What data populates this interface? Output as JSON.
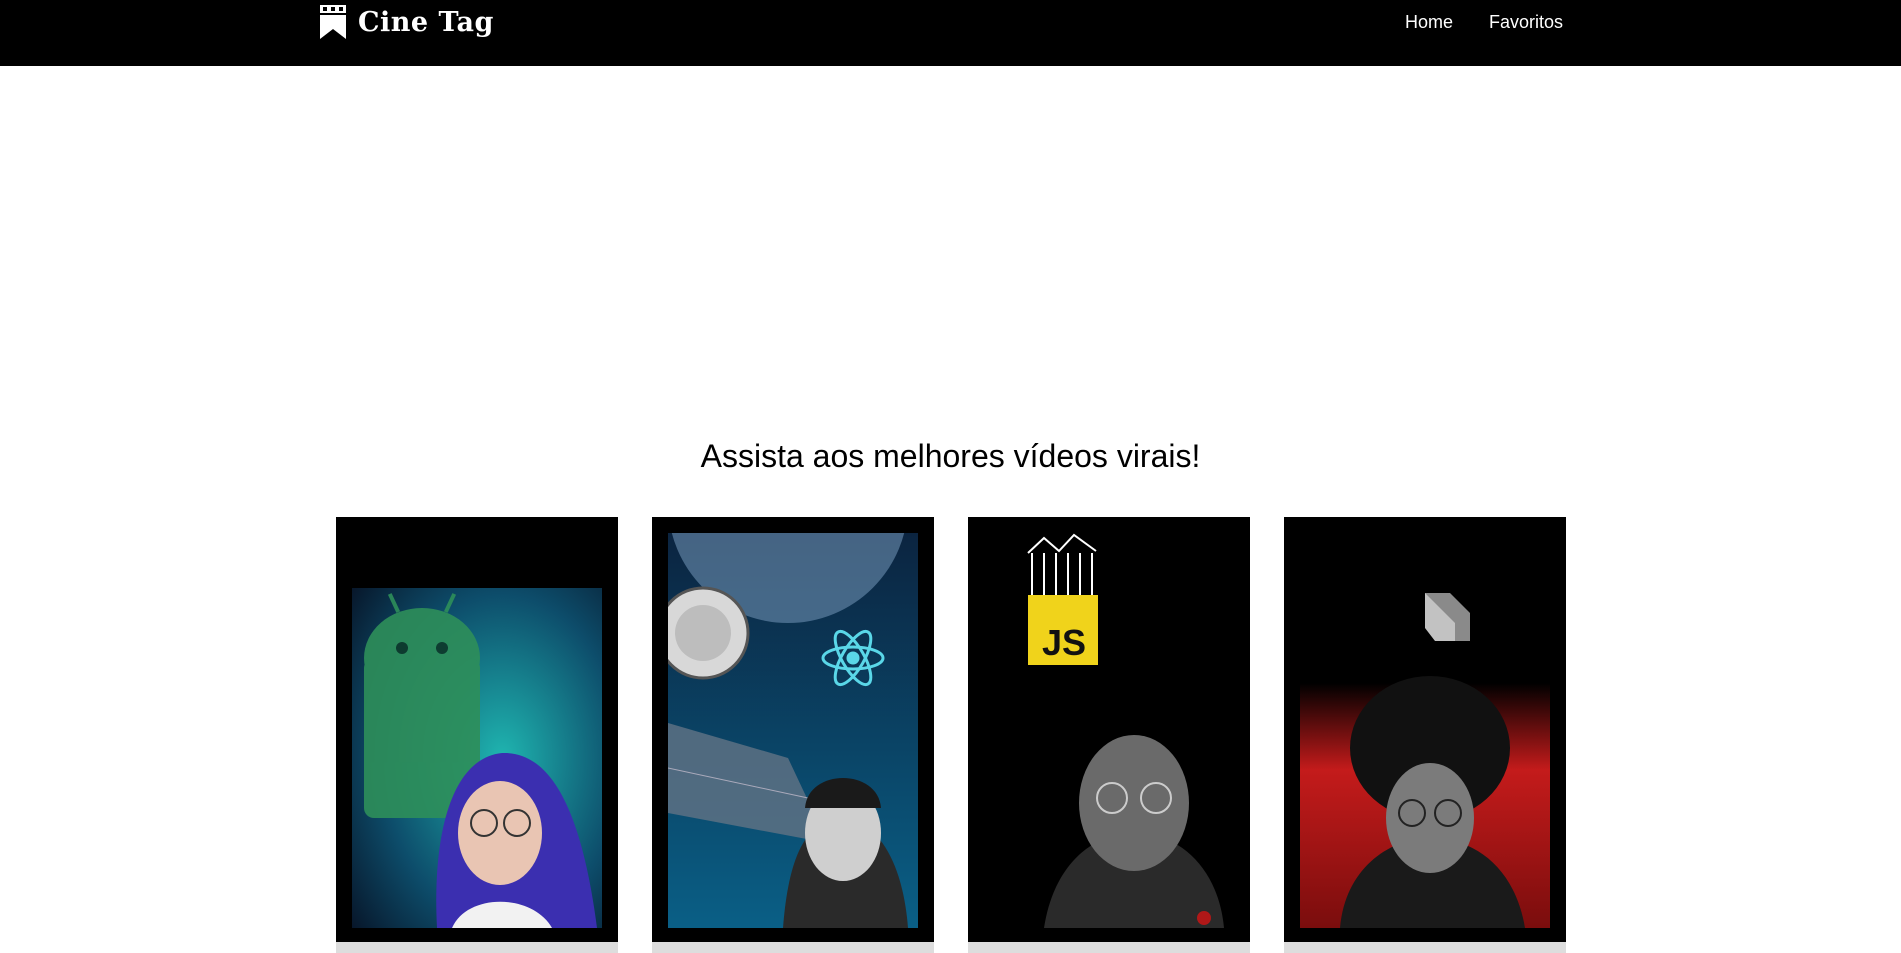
{
  "header": {
    "logo_text": "Cine Tag",
    "logo_icon": "bookmark-film-icon",
    "nav": [
      {
        "label": "Home"
      },
      {
        "label": "Favoritos"
      }
    ]
  },
  "main": {
    "headline": "Assista aos melhores vídeos virais!",
    "cards": [
      {
        "theme": "android",
        "icon": "android-icon",
        "accent": "#1fb5b0"
      },
      {
        "theme": "react",
        "icon": "react-atom-icon",
        "accent": "#5ad7e8"
      },
      {
        "theme": "javascript",
        "icon": "javascript-logo-icon",
        "accent": "#f0d31b"
      },
      {
        "theme": "dart",
        "icon": "dart-logo-icon",
        "accent": "#c41b1b"
      }
    ]
  },
  "colors": {
    "header_bg": "#000000",
    "page_bg": "#ffffff",
    "card_frame": "#000000"
  }
}
